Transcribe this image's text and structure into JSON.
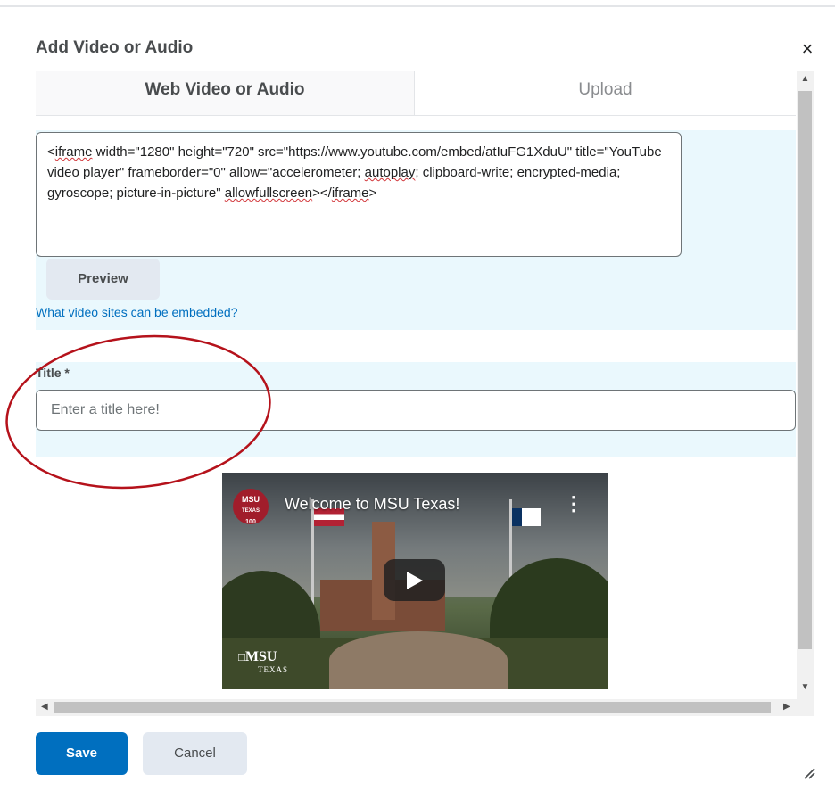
{
  "dialog": {
    "title": "Add Video or Audio",
    "close_icon": "close-icon",
    "close_glyph": "×"
  },
  "tabs": [
    {
      "label": "Web Video or Audio",
      "selected": true
    },
    {
      "label": "Upload",
      "selected": false
    }
  ],
  "embed": {
    "code_parts": [
      "<",
      "iframe",
      " width=\"1280\" height=\"720\" src=\"https://www.youtube.com/embed/atIuFG1XduU\" title=\"YouTube video player\" frameborder=\"0\" allow=\"accelerometer; ",
      "autoplay",
      "; clipboard-write; encrypted-media; gyroscope; picture-in-picture\" ",
      "allowfullscreen",
      "></",
      "iframe",
      ">"
    ],
    "preview_label": "Preview",
    "help_link": "What video sites can be embedded?"
  },
  "title_field": {
    "label": "Title *",
    "value": "",
    "placeholder": "Enter a title here!"
  },
  "video": {
    "title": "Welcome to MSU Texas!",
    "channel_logo_line1": "MSU",
    "channel_logo_line2": "TEXAS",
    "channel_logo_line3": "100",
    "watermark_line1": "MSU",
    "watermark_line2": "TEXAS",
    "menu_glyph": "⋮"
  },
  "footer": {
    "save_label": "Save",
    "cancel_label": "Cancel"
  },
  "colors": {
    "primary": "#006fbf",
    "section_bg": "#eaf8fd",
    "annotation": "#b5121b"
  },
  "scrollbars": {
    "up": "▲",
    "down": "▼",
    "left": "◀",
    "right": "▶"
  }
}
